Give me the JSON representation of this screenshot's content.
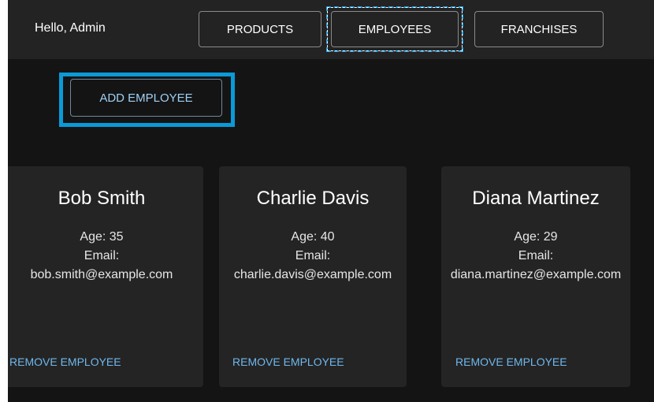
{
  "header": {
    "greeting": "Hello, Admin",
    "nav": {
      "products": "PRODUCTS",
      "employees": "EMPLOYEES",
      "franchises": "FRANCHISES"
    }
  },
  "actions": {
    "add_employee": "ADD EMPLOYEE"
  },
  "employees": [
    {
      "name": "Bob Smith",
      "age": "Age: 35",
      "email_label": "Email:",
      "email": "bob.smith@example.com",
      "remove_label": "REMOVE EMPLOYEE"
    },
    {
      "name": "Charlie Davis",
      "age": "Age: 40",
      "email_label": "Email:",
      "email": "charlie.davis@example.com",
      "remove_label": "REMOVE EMPLOYEE"
    },
    {
      "name": "Diana Martinez",
      "age": "Age: 29",
      "email_label": "Email:",
      "email": "diana.martinez@example.com",
      "remove_label": "REMOVE EMPLOYEE"
    }
  ],
  "colors": {
    "background": "#141414",
    "topbar": "#232323",
    "card": "#242424",
    "accent_text": "#6fb8ee",
    "focus_ring": "#0a9ad8"
  }
}
